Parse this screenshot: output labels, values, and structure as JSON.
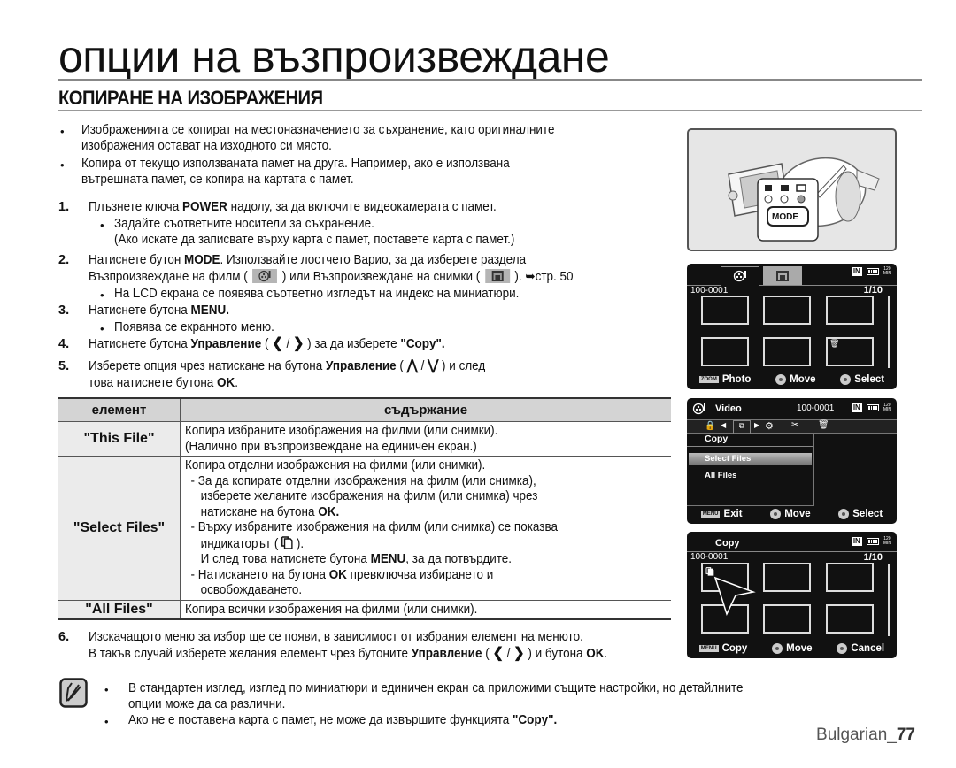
{
  "page": {
    "title": "опции на възпроизвеждане",
    "section_title": "КОПИРАНЕ НА ИЗОБРАЖЕНИЯ",
    "footer_page": "Bulgarian_",
    "footer_page_number": "77"
  },
  "intro": [
    {
      "line1": "Изображенията се копират на местоназначението за съхранение, като оригиналните",
      "line2": "изображения остават на изходното си място."
    },
    {
      "line1": "Копира от текущо използваната памет на друга. Например, ако е използвана",
      "line2": "вътрешната памет, се копира на картата с памет."
    }
  ],
  "steps": {
    "s1": {
      "num": "1.",
      "pre": "Плъзнете ключа ",
      "bold": "POWER",
      "post": " надолу, за да включите видеокамерата с памет.",
      "sub1": "Задайте съответните носители за съхранение.",
      "sub2": "(Ако искате да записвате върху карта с памет, поставете карта с памет.)"
    },
    "s2": {
      "num": "2.",
      "pre": "Натиснете бутон ",
      "bold": "MODE",
      "post": ". Използвайте лостчето Варио, за да изберете раздела",
      "l2a": "Възпроизвеждане на филм (",
      "l2b": ") или Възпроизвеждане на снимки (",
      "l2c": "). ➥стр. 50",
      "sub_pre": "На ",
      "sub_bold": "L",
      "sub_post": "CD екрана се появява съответно изгледът на индекс на миниатюри."
    },
    "s3": {
      "num": "3.",
      "pre": "Натиснете бутона ",
      "bold": "MENU.",
      "sub": "Появява се екранното меню."
    },
    "s4": {
      "num": "4.",
      "pre": "Натиснете бутона ",
      "bold": "Управление",
      "mid": " ( ",
      "chev_l": "❮",
      "sep": " / ",
      "chev_r": "❯",
      "post": " ) за да изберете ",
      "bold2": "\"Copy\"."
    },
    "s5": {
      "num": "5.",
      "pre": "Изберете опция чрез натискане на бутона ",
      "bold": "Управление",
      "mid": " ( ",
      "chev_u": "⋀",
      "sep": " / ",
      "chev_d": "⋁",
      "post": " ) и след",
      "l2_pre": "това натиснете бутона ",
      "l2_bold": "OK",
      "l2_post": "."
    },
    "s6": {
      "num": "6.",
      "line1": "Изскачащото меню за избор ще се появи, в зависимост от избрания елемент на менюто.",
      "l2_pre": "В такъв случай изберете желания елемент чрез бутоните ",
      "l2_bold": "Управление",
      "l2_mid": " ( ",
      "chev_l": "❮",
      "sep": " / ",
      "chev_r": "❯",
      "l2_post": " ) и бутона ",
      "l2_bold2": "OK",
      "l2_end": "."
    }
  },
  "table": {
    "headers": [
      "елемент",
      "съдържание"
    ],
    "rows": [
      {
        "item": "\"This File\"",
        "lines": [
          "Копира избраните изображения на филми (или снимки).",
          "(Налично при възпроизвеждане на единичен екран.)"
        ]
      },
      {
        "item": "\"Select Files\"",
        "l1": "Копира отделни изображения на филми (или снимки).",
        "l2": "- За да копирате отделни изображения на филм (или снимка),",
        "l3": "изберете желаните изображения на филм (или снимка) чрез",
        "l4_pre": "натискане на бутона ",
        "l4_bold": "OK.",
        "l5": "- Върху избраните изображения на филм (или снимка) се показва",
        "l6_pre": "индикаторът ( ",
        "l6_post": " ).",
        "l7_pre": "И след това натиснете бутона ",
        "l7_bold": "MENU",
        "l7_post": ", за да потвърдите.",
        "l8_pre": "- Натискането на бутона ",
        "l8_bold": "OK",
        "l8_post": " превключва избирането и",
        "l9": "освобождаването."
      },
      {
        "item": "\"All Files\"",
        "lines": [
          "Копира всички изображения на филми (или снимки)."
        ]
      }
    ]
  },
  "notes": [
    {
      "line1": "В стандартен изглед, изглед по миниатюри и единичен екран са приложими същите настройки, но детайлните",
      "line2": "опции може да са различни."
    },
    {
      "pre": "Ако не е поставена карта с памет, не може да извършите функцията ",
      "bold": "\"Copy\"."
    }
  ],
  "camera_illustration": {
    "mode_label": "MODE"
  },
  "screen1": {
    "file_id": "100-0001",
    "counter": "1/10",
    "storage": "IN",
    "minutes_top": "120",
    "minutes_bottom": "MIN",
    "footer": [
      {
        "key": "ZOOM",
        "label": "Photo"
      },
      {
        "label": "Move"
      },
      {
        "label": "Select"
      }
    ]
  },
  "screen2": {
    "mode_label": "Video",
    "file_id": "100-0001",
    "storage": "IN",
    "minutes_top": "120",
    "minutes_bottom": "MIN",
    "menu_title": "Copy",
    "menu_items": [
      "Select Files",
      "All Files"
    ],
    "selected_index": 0,
    "footer": [
      {
        "key": "MENU",
        "label": "Exit"
      },
      {
        "label": "Move"
      },
      {
        "label": "Select"
      }
    ]
  },
  "screen3": {
    "title": "Copy",
    "file_id": "100-0001",
    "counter": "1/10",
    "storage": "IN",
    "minutes_top": "120",
    "minutes_bottom": "MIN",
    "footer": [
      {
        "key": "MENU",
        "label": "Copy"
      },
      {
        "label": "Move"
      },
      {
        "label": "Cancel"
      }
    ]
  }
}
